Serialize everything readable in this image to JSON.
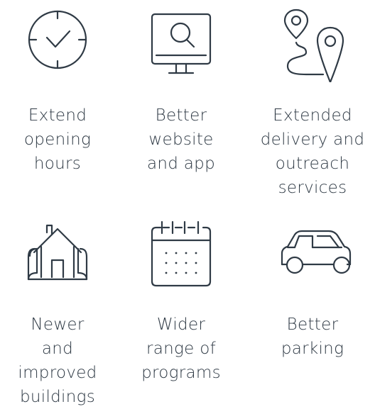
{
  "benefits": [
    {
      "icon": "clock-icon",
      "lines": [
        "Extend",
        "opening",
        "hours"
      ]
    },
    {
      "icon": "monitor-search-icon",
      "lines": [
        "Better",
        "website",
        "and app"
      ]
    },
    {
      "icon": "route-map-pin-icon",
      "lines": [
        "Extended",
        "delivery and",
        "outreach",
        "services"
      ]
    },
    {
      "icon": "house-blueprint-icon",
      "lines": [
        "Newer",
        "and",
        "improved",
        "buildings"
      ]
    },
    {
      "icon": "calendar-icon",
      "lines": [
        "Wider",
        "range of",
        "programs"
      ]
    },
    {
      "icon": "car-icon",
      "lines": [
        "Better",
        "parking"
      ]
    }
  ],
  "colors": {
    "ink": "#2f3a45",
    "background": "#ffffff"
  }
}
